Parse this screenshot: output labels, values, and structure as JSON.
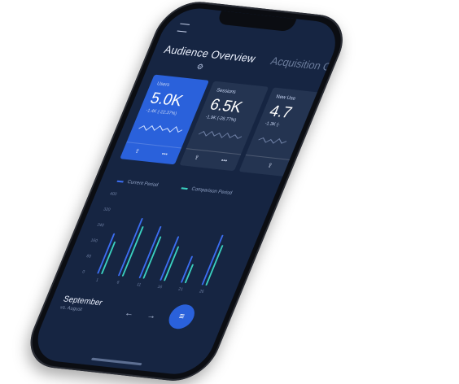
{
  "header": {
    "tabs": [
      {
        "label": "Audience Overview",
        "active": true
      },
      {
        "label": "Acquisition O",
        "active": false
      }
    ]
  },
  "cards": [
    {
      "label": "Users",
      "value": "5.0K",
      "change": "-1.4K (-22.37%)",
      "active": true
    },
    {
      "label": "Sessions",
      "value": "6.5K",
      "change": "-1.9K (-26.77%)",
      "active": false
    },
    {
      "label": "New Use",
      "value": "4.7",
      "change": "-1.3K (-",
      "active": false
    }
  ],
  "legend": {
    "current_label": "Current Period",
    "comparison_label": "Comparison Period",
    "current_color": "#3b6df0",
    "comparison_color": "#3ad1c0"
  },
  "chart_data": {
    "type": "bar",
    "title": "",
    "xlabel": "",
    "ylabel": "",
    "yticks": [
      "400",
      "320",
      "240",
      "160",
      "80",
      "0"
    ],
    "xticks": [
      "1",
      "6",
      "11",
      "16",
      "21",
      "26"
    ],
    "ylim": [
      0,
      400
    ],
    "series": [
      {
        "name": "Current Period",
        "values": [
          200,
          290,
          260,
          220,
          130,
          250
        ]
      },
      {
        "name": "Comparison Period",
        "values": [
          160,
          250,
          210,
          170,
          90,
          200
        ]
      }
    ]
  },
  "footer": {
    "month": "September",
    "compare": "vs. August"
  },
  "icons": {
    "menu": "menu-icon",
    "settings": "gear-icon",
    "share": "share-icon",
    "more": "more-icon",
    "prev": "arrow-left-icon",
    "next": "arrow-right-icon",
    "filter": "filter-icon"
  }
}
